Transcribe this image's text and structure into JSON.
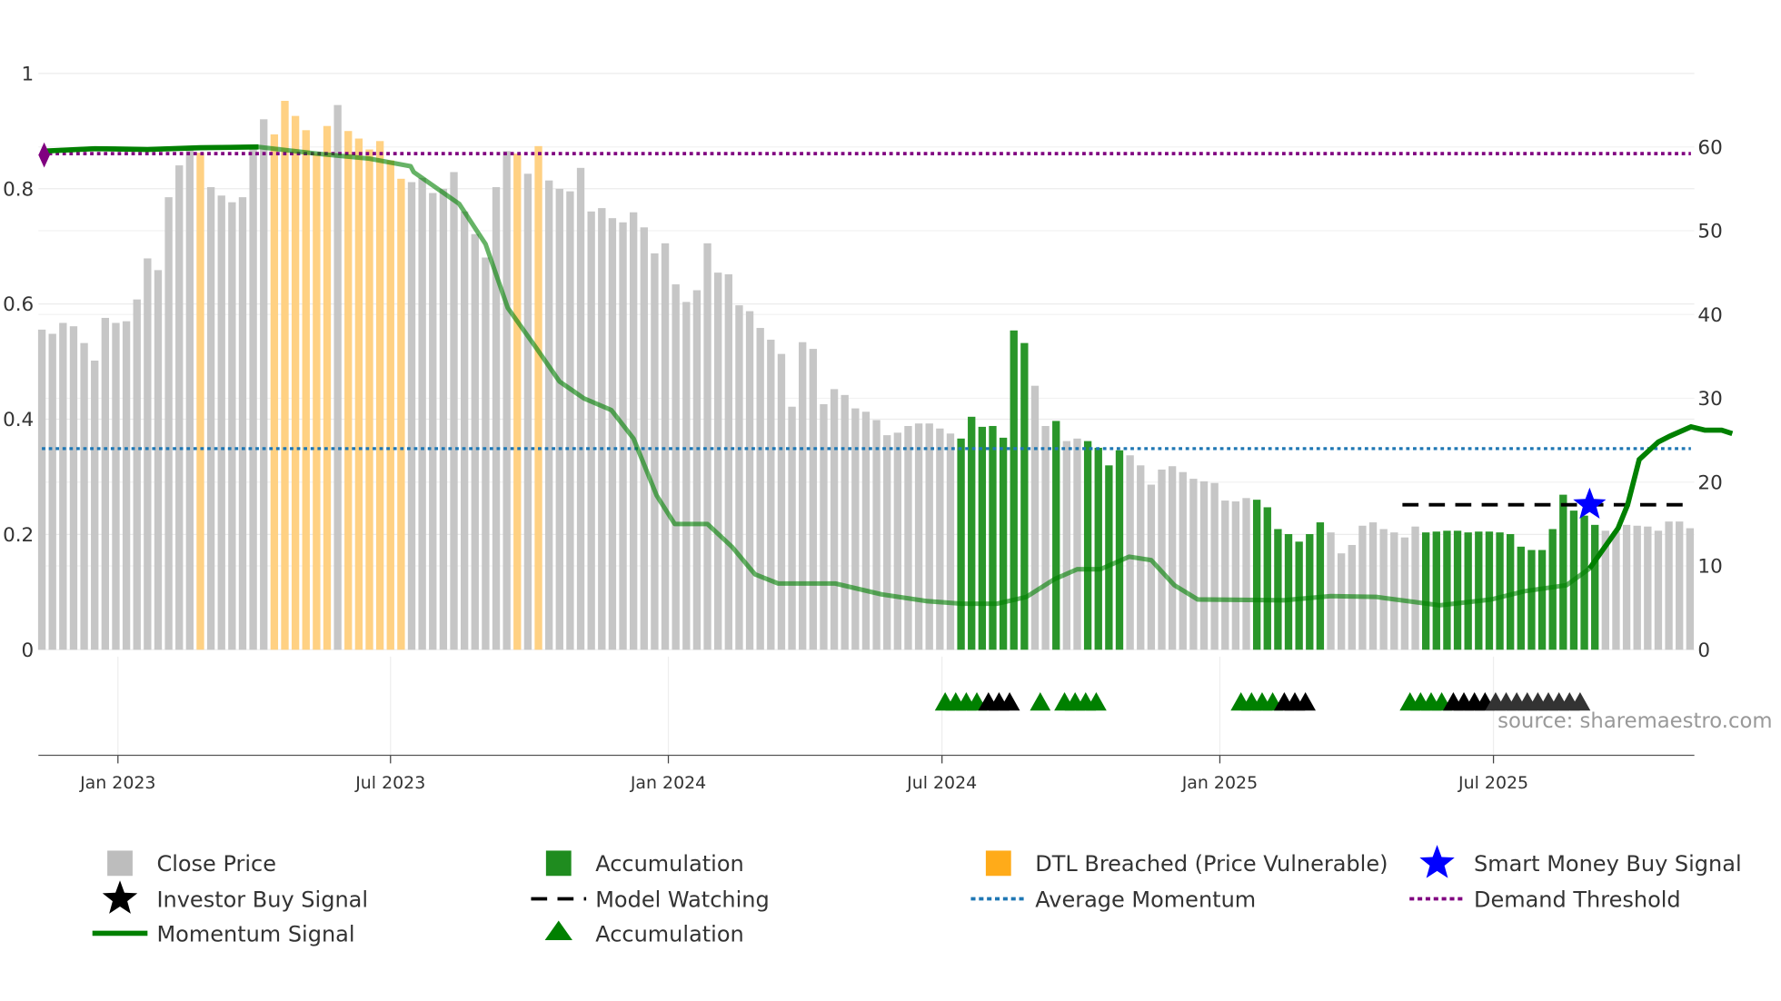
{
  "chart_data": {
    "type": "bar",
    "title": "",
    "source": "source: sharemaestro.com",
    "left_axis": {
      "ticks": [
        "0",
        "0.2",
        "0.4",
        "0.6",
        "0.8",
        "1"
      ],
      "range": [
        0,
        1
      ]
    },
    "right_axis": {
      "ticks": [
        "0",
        "10",
        "20",
        "30",
        "40",
        "50",
        "60"
      ],
      "range": [
        0,
        60
      ]
    },
    "x_ticks": [
      {
        "label": "Jan 2023",
        "bar_index": 7.2
      },
      {
        "label": "Jul 2023",
        "bar_index": 33
      },
      {
        "label": "Jan 2024",
        "bar_index": 59.3
      },
      {
        "label": "Jul 2024",
        "bar_index": 85.2
      },
      {
        "label": "Jan 2025",
        "bar_index": 111.5
      },
      {
        "label": "Jul 2025",
        "bar_index": 137.4
      }
    ],
    "close_price": [
      38.2,
      37.7,
      39,
      38.6,
      36.6,
      34.5,
      39.6,
      39,
      39.2,
      41.8,
      46.7,
      45.3,
      54,
      57.8,
      59.7,
      59.3,
      55.2,
      54.2,
      53.4,
      54,
      59.7,
      63.3,
      61.5,
      65.5,
      63.7,
      62,
      59.2,
      62.5,
      65,
      61.9,
      61,
      59.7,
      60.7,
      58.4,
      56.2,
      55.8,
      56.3,
      54.5,
      55,
      57,
      52.3,
      49.6,
      46.8,
      55.2,
      59.5,
      59.2,
      56.8,
      60.1,
      56,
      55,
      54.7,
      57.5,
      52.3,
      52.7,
      51.5,
      51,
      52.2,
      50.4,
      47.3,
      48.5,
      43.6,
      41.5,
      42.9,
      48.5,
      45,
      44.8,
      41.1,
      40.4,
      38.4,
      37,
      35.3,
      29,
      36.7,
      35.9,
      29.3,
      31.1,
      30.4,
      28.8,
      28.4,
      27.4,
      25.6,
      25.9,
      26.7,
      27,
      27,
      26.4,
      25.8,
      25.2,
      27.8,
      26.6,
      26.7,
      25.3,
      38.1,
      36.6,
      31.5,
      26.7,
      27.3,
      24.9,
      25.2,
      24.9,
      24.1,
      22,
      23.8,
      23.2,
      22,
      19.7,
      21.5,
      21.9,
      21.2,
      20.4,
      20.1,
      19.9,
      17.8,
      17.7,
      18.1,
      17.9,
      17,
      14.4,
      13.8,
      12.9,
      13.8,
      15.2,
      14,
      11.5,
      12.5,
      14.8,
      15.2,
      14.4,
      14,
      13.4,
      14.7,
      14,
      14.1,
      14.2,
      14.2,
      14,
      14.1,
      14.1,
      14,
      13.8,
      12.3,
      11.9,
      11.9,
      14.4,
      18.5,
      16.6,
      16,
      14.9,
      14.2,
      14.1,
      14.9,
      14.8,
      14.7,
      14.2,
      15.3,
      15.3,
      14.5
    ],
    "bar_state": "gggggggggggggggoggggggoooooogooooooggggggggggogogggggggggggggggggggggggggggggggggggggggaaaaaaaggaggaaaaggggggggggggaaaaaaagggggggggaaaaaaaaaaaaaaaaaggggggggggg",
    "bar_state_legend": {
      "g": "Close Price",
      "a": "Accumulation",
      "o": "DTL Breached (Price Vulnerable)"
    },
    "momentum_signal": [
      [
        0,
        59.5
      ],
      [
        5,
        59.8
      ],
      [
        10,
        59.7
      ],
      [
        15,
        59.9
      ],
      [
        20.5,
        60
      ],
      [
        26,
        59.2
      ],
      [
        31,
        58.6
      ],
      [
        34.9,
        57.7
      ],
      [
        35.2,
        57
      ],
      [
        39.5,
        53.2
      ],
      [
        42,
        48.4
      ],
      [
        44.1,
        40.8
      ],
      [
        46.8,
        36
      ],
      [
        49,
        32
      ],
      [
        51.3,
        30
      ],
      [
        53.9,
        28.6
      ],
      [
        56,
        25.2
      ],
      [
        58.2,
        18.4
      ],
      [
        59.9,
        15
      ],
      [
        63,
        15
      ],
      [
        65.3,
        12.3
      ],
      [
        67.5,
        9
      ],
      [
        69.7,
        7.9
      ],
      [
        75.1,
        7.9
      ],
      [
        79.5,
        6.6
      ],
      [
        83.8,
        5.8
      ],
      [
        87.1,
        5.5
      ],
      [
        90.4,
        5.5
      ],
      [
        93.2,
        6.3
      ],
      [
        95.8,
        8.4
      ],
      [
        98,
        9.6
      ],
      [
        100.2,
        9.6
      ],
      [
        102.9,
        11.1
      ],
      [
        105,
        10.7
      ],
      [
        107.2,
        7.7
      ],
      [
        109.4,
        6
      ],
      [
        117.6,
        5.9
      ],
      [
        122,
        6.4
      ],
      [
        126.3,
        6.3
      ],
      [
        132.3,
        5.3
      ],
      [
        137.2,
        6
      ],
      [
        140.4,
        7
      ],
      [
        144.3,
        7.7
      ],
      [
        146.5,
        9.7
      ],
      [
        149.2,
        14.5
      ],
      [
        150.1,
        17.3
      ],
      [
        151.2,
        22.7
      ],
      [
        153,
        24.8
      ],
      [
        154.1,
        25.5
      ],
      [
        156.1,
        26.6
      ],
      [
        157.4,
        26.2
      ],
      [
        159,
        26.2
      ],
      [
        160,
        25.8
      ]
    ],
    "demand_threshold": 59.2,
    "average_momentum": 24,
    "model_watching": {
      "value": 17.3,
      "from_bar": 129,
      "to_bar": 156
    },
    "smart_money_buy_signal": {
      "bar": 146.5,
      "value": 17.3
    },
    "accumulation_markers": [
      {
        "bars": [
          85.5,
          86.5,
          87.5,
          88.5
        ],
        "kind": "accumulation"
      },
      {
        "bars": [
          89.6,
          90.6,
          91.6
        ],
        "kind": "investor"
      },
      {
        "bars": [
          94.5
        ],
        "kind": "accumulation"
      },
      {
        "bars": [
          96.8,
          97.8,
          98.8,
          99.8
        ],
        "kind": "accumulation"
      },
      {
        "bars": [
          113.5,
          114.5,
          115.5,
          116.5
        ],
        "kind": "accumulation"
      },
      {
        "bars": [
          117.6,
          118.6,
          119.6
        ],
        "kind": "investor"
      },
      {
        "bars": [
          129.5,
          130.5,
          131.5,
          132.5
        ],
        "kind": "accumulation"
      },
      {
        "bars": [
          133.6,
          134.6,
          135.6,
          136.6
        ],
        "kind": "investor"
      },
      {
        "bars": [
          137.6,
          138.6,
          139.6,
          140.6,
          141.6,
          142.6,
          143.6,
          144.6,
          145.6
        ],
        "kind": "watching"
      }
    ],
    "legend": [
      {
        "label": "Close Price",
        "icon": "square",
        "color": "#bdbdbd"
      },
      {
        "label": "Accumulation",
        "icon": "square",
        "color": "#1f8c1f"
      },
      {
        "label": "DTL Breached (Price Vulnerable)",
        "icon": "square",
        "color": "#ffab19"
      },
      {
        "label": "Smart Money Buy Signal",
        "icon": "star",
        "color": "#0000ff"
      },
      {
        "label": "Investor Buy Signal",
        "icon": "star",
        "color": "#000000"
      },
      {
        "label": "Model Watching",
        "icon": "dash",
        "color": "#000000"
      },
      {
        "label": "Average Momentum",
        "icon": "dot",
        "color": "#1f77b4"
      },
      {
        "label": "Demand Threshold",
        "icon": "dot",
        "color": "#800080"
      },
      {
        "label": "Momentum Signal",
        "icon": "line",
        "color": "#008000"
      },
      {
        "label": "Accumulation",
        "icon": "triangle",
        "color": "#008000"
      }
    ],
    "colors": {
      "grey": "#c6c6c6",
      "green": "#2a962a",
      "orange": "#ffd183",
      "momentum": "#008000",
      "avg": "#1f77b4",
      "demand": "#800080",
      "star": "#0000ff"
    }
  }
}
